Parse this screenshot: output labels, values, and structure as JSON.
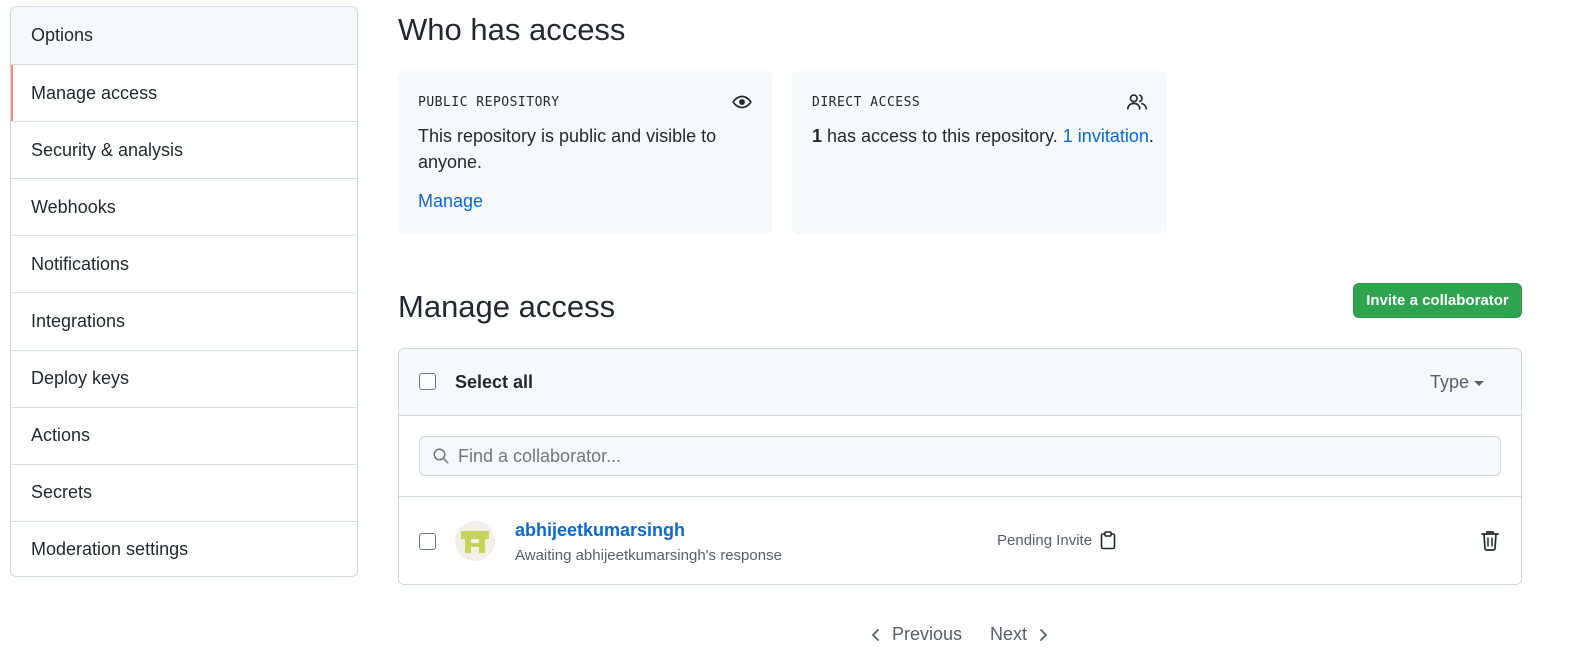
{
  "sidebar": {
    "items": [
      {
        "label": "Options"
      },
      {
        "label": "Manage access"
      },
      {
        "label": "Security & analysis"
      },
      {
        "label": "Webhooks"
      },
      {
        "label": "Notifications"
      },
      {
        "label": "Integrations"
      },
      {
        "label": "Deploy keys"
      },
      {
        "label": "Actions"
      },
      {
        "label": "Secrets"
      },
      {
        "label": "Moderation settings"
      }
    ],
    "active_label": "Manage access"
  },
  "who_has_access": {
    "title": "Who has access",
    "public_card": {
      "label": "PUBLIC REPOSITORY",
      "icon": "eye-icon",
      "text": "This repository is public and visible to anyone.",
      "link": "Manage"
    },
    "direct_card": {
      "label": "DIRECT ACCESS",
      "icon": "people-icon",
      "count": "1",
      "text": " has access to this repository. ",
      "link": "1 invitation",
      "suffix": "."
    }
  },
  "manage_access": {
    "title": "Manage access",
    "invite_button": "Invite a collaborator",
    "select_all": "Select all",
    "type_filter": "Type",
    "search_placeholder": "Find a collaborator...",
    "collaborators": [
      {
        "username": "abhijeetkumarsingh",
        "subtitle": "Awaiting abhijeetkumarsingh's response",
        "status": "Pending Invite"
      }
    ]
  },
  "pagination": {
    "previous": "Previous",
    "next": "Next"
  },
  "colors": {
    "accent_link": "#0969da",
    "invite_green": "#2da44e",
    "active_marker": "#fd8c73"
  }
}
